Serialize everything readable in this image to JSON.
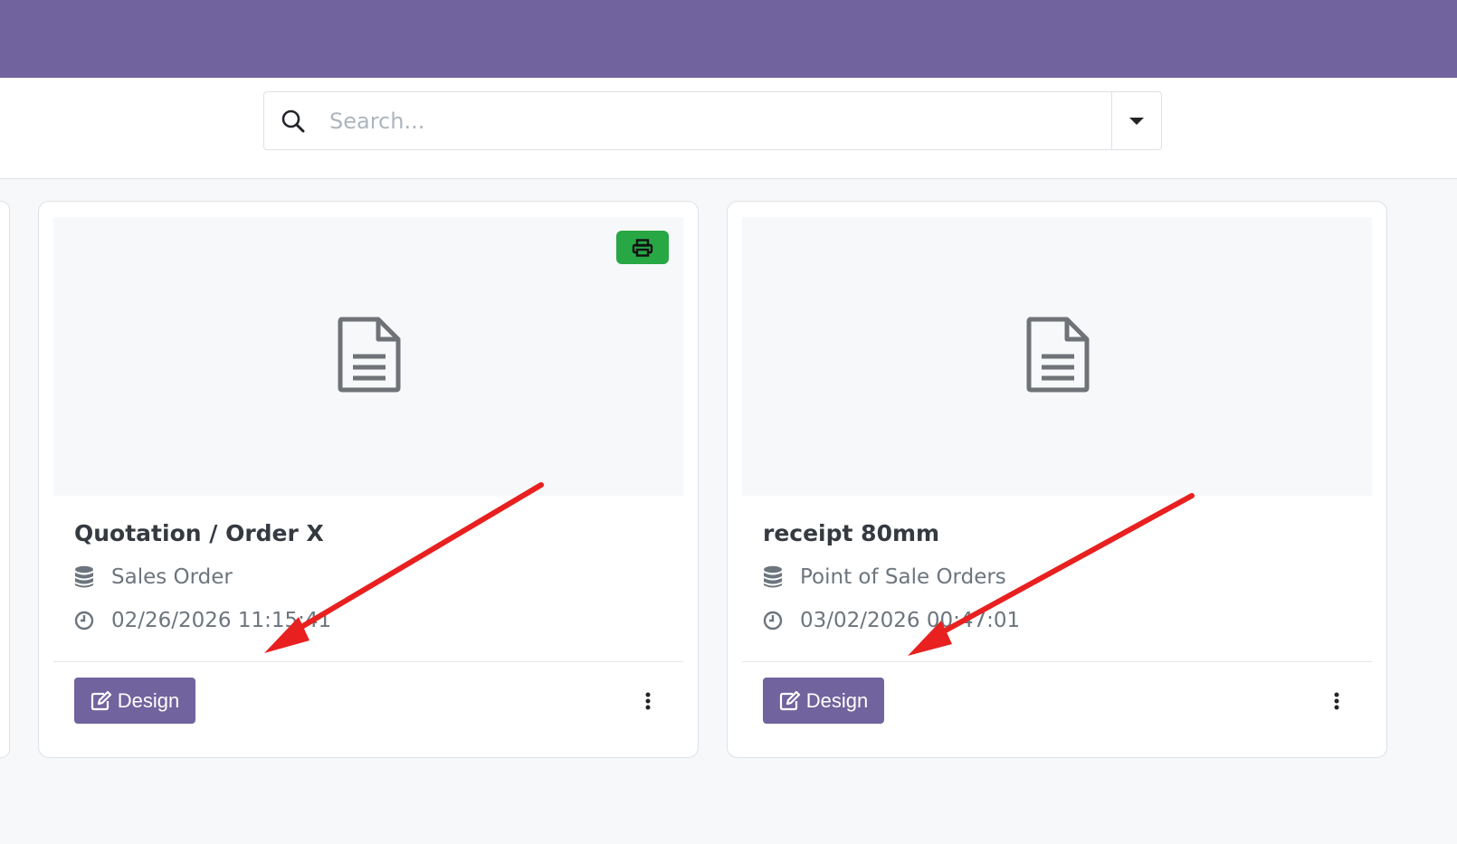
{
  "search": {
    "placeholder": "Search..."
  },
  "cards": [
    {
      "title": "Quotation / Order X",
      "model": "Sales Order",
      "date": "02/26/2026 11:15:41",
      "design_label": "Design",
      "has_print_badge": true
    },
    {
      "title": "receipt 80mm",
      "model": "Point of Sale Orders",
      "date": "03/02/2026 00:47:01",
      "design_label": "Design",
      "has_print_badge": false
    }
  ],
  "icons": {
    "search": "search-icon",
    "dropdown": "caret-down-icon",
    "document": "file-text-icon",
    "print": "printer-icon",
    "database": "database-icon",
    "clock": "clock-icon",
    "edit": "edit-icon",
    "more": "vertical-ellipsis-icon"
  },
  "colors": {
    "brand": "#71639e",
    "print_badge": "#28a745",
    "annotation_arrow": "#e8201f"
  }
}
